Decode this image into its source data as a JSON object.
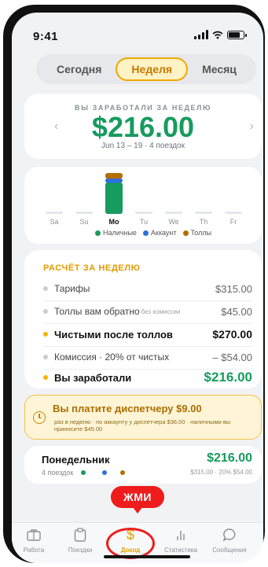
{
  "status": {
    "time": "9:41"
  },
  "segments": [
    {
      "label": "Сегодня",
      "active": false
    },
    {
      "label": "Неделя",
      "active": true
    },
    {
      "label": "Месяц",
      "active": false
    }
  ],
  "earnings": {
    "caption": "ВЫ ЗАРАБОТАЛИ ЗА НЕДЕЛЮ",
    "amount": "$216.00",
    "range": "Jun 13 – 19 · 4 поездок"
  },
  "chart_data": {
    "type": "bar",
    "categories": [
      "Sa",
      "Su",
      "Mo",
      "Tu",
      "We",
      "Th",
      "Fr"
    ],
    "selected": "Mo",
    "stacked": true,
    "series": [
      {
        "name": "Наличные",
        "color": "#179b5e",
        "values": [
          0,
          0,
          270,
          0,
          0,
          0,
          0
        ]
      },
      {
        "name": "Аккаунт",
        "color": "#2f6fe0",
        "values": [
          0,
          0,
          36,
          0,
          0,
          0,
          0
        ]
      },
      {
        "name": "Толлы",
        "color": "#b26f00",
        "values": [
          0,
          0,
          45,
          0,
          0,
          0,
          0
        ]
      }
    ]
  },
  "calc": {
    "header": "РАСЧЁТ ЗА НЕДЕЛЮ",
    "rows": [
      {
        "label": "Тарифы",
        "note": "",
        "value": "$315.00"
      },
      {
        "label": "Толлы вам обратно",
        "note": "без комиссии",
        "value": "$45.00"
      },
      {
        "label": "Чистыми после толлов",
        "note": "",
        "value": "$270.00"
      },
      {
        "label": "Комиссия · 20% от чистых",
        "note": "",
        "value": "– $54.00"
      },
      {
        "label": "Вы заработали",
        "note": "",
        "value": "$216.00"
      }
    ]
  },
  "dispatcher": {
    "title": "Вы платите диспетчеру $9.00",
    "note": "раз в неделю · по аккаунту у диспетчера $36.00 · наличными вы приносите $45.00"
  },
  "day": {
    "name": "Понедельник",
    "trips": "4 поездок",
    "amount": "$216.00",
    "detail": "$315.00 · 20% $54.00"
  },
  "callout": "ЖМИ",
  "tabs": [
    {
      "label": "Работа",
      "icon": "briefcase-icon",
      "active": false
    },
    {
      "label": "Поездки",
      "icon": "clipboard-icon",
      "active": false
    },
    {
      "label": "Доход",
      "icon": "dollar-icon",
      "active": true
    },
    {
      "label": "Статистика",
      "icon": "bar-chart-icon",
      "active": false
    },
    {
      "label": "Сообщения",
      "icon": "chat-bubble-icon",
      "active": false
    }
  ]
}
